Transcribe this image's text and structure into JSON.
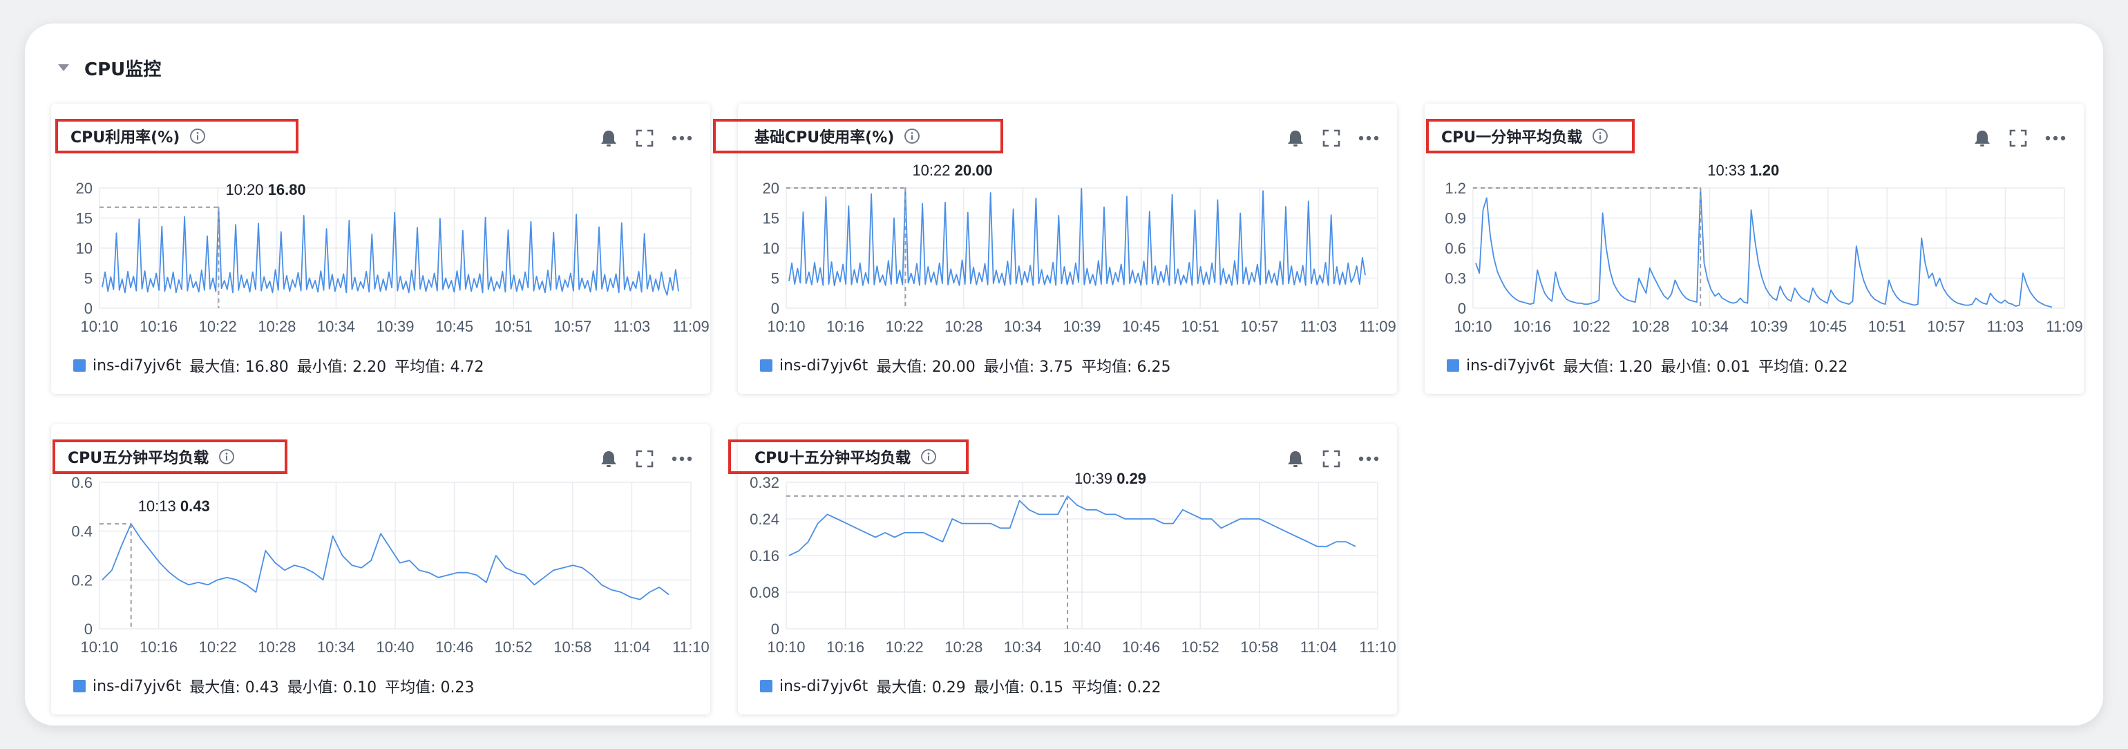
{
  "section": {
    "title": "CPU监控"
  },
  "legend_text": {
    "max": "最大值",
    "min": "最小值",
    "avg": "平均值"
  },
  "icons": {
    "bell": "bell-icon",
    "fullscreen": "fullscreen-icon",
    "more": "more-icon",
    "info": "info-icon",
    "collapse": "caret-down-icon"
  },
  "colors": {
    "series": "#4a8fe7",
    "highlight": "#e0302b",
    "grid": "#e9ebef",
    "axis_text": "#4e5969"
  },
  "cards": [
    {
      "title": "CPU利用率(%)",
      "series_name": "ins-di7yjv6t",
      "max_value": "16.80",
      "min_value": "2.20",
      "avg_value": "4.72",
      "tooltip_time": "10:20",
      "tooltip_value": "16.80"
    },
    {
      "title": "基础CPU使用率(%)",
      "series_name": "ins-di7yjv6t",
      "max_value": "20.00",
      "min_value": "3.75",
      "avg_value": "6.25",
      "tooltip_time": "10:22",
      "tooltip_value": "20.00"
    },
    {
      "title": "CPU一分钟平均负载",
      "series_name": "ins-di7yjv6t",
      "max_value": "1.20",
      "min_value": "0.01",
      "avg_value": "0.22",
      "tooltip_time": "10:33",
      "tooltip_value": "1.20"
    },
    {
      "title": "CPU五分钟平均负载",
      "series_name": "ins-di7yjv6t",
      "max_value": "0.43",
      "min_value": "0.10",
      "avg_value": "0.23",
      "tooltip_time": "10:13",
      "tooltip_value": "0.43"
    },
    {
      "title": "CPU十五分钟平均负载",
      "series_name": "ins-di7yjv6t",
      "max_value": "0.29",
      "min_value": "0.15",
      "avg_value": "0.22",
      "tooltip_time": "10:39",
      "tooltip_value": "0.29"
    }
  ],
  "chart_data": [
    {
      "type": "line",
      "title": "CPU利用率(%)",
      "ylim": [
        0,
        20
      ],
      "y_ticks": [
        "0",
        "5",
        "10",
        "15",
        "20"
      ],
      "x_ticks": [
        "10:10",
        "10:16",
        "10:22",
        "10:28",
        "10:34",
        "10:39",
        "10:45",
        "10:51",
        "10:57",
        "11:03",
        "11:09"
      ],
      "grid": true,
      "legend_position": "bottom-left",
      "series": [
        {
          "name": "ins-di7yjv6t",
          "values": [
            3.5,
            6.0,
            2.8,
            5.2,
            3.1,
            12.5,
            3.0,
            4.8,
            2.6,
            6.1,
            3.4,
            5.3,
            2.9,
            14.8,
            3.2,
            6.2,
            2.7,
            4.9,
            3.5,
            5.8,
            3.0,
            13.6,
            2.8,
            5.1,
            3.3,
            6.0,
            2.6,
            4.7,
            3.1,
            15.2,
            2.9,
            5.6,
            3.4,
            4.4,
            2.7,
            6.3,
            3.0,
            12.0,
            3.2,
            5.0,
            2.8,
            16.8,
            3.3,
            4.6,
            3.1,
            5.9,
            2.6,
            13.9,
            3.0,
            5.5,
            3.4,
            4.8,
            2.7,
            6.0,
            3.1,
            14.1,
            2.9,
            5.2,
            3.3,
            4.5,
            2.6,
            6.4,
            3.0,
            12.7,
            3.2,
            5.4,
            2.8,
            4.7,
            3.5,
            5.9,
            2.9,
            15.4,
            3.1,
            5.0,
            3.3,
            4.6,
            2.7,
            6.2,
            3.0,
            13.2,
            3.2,
            5.6,
            2.8,
            4.9,
            3.4,
            5.7,
            2.6,
            14.6,
            3.1,
            5.1,
            2.9,
            4.4,
            3.3,
            6.1,
            2.7,
            12.3,
            3.2,
            5.5,
            2.8,
            4.8,
            3.0,
            6.0,
            3.4,
            15.9,
            2.9,
            5.3,
            3.1,
            4.5,
            2.6,
            6.3,
            3.0,
            13.4,
            3.2,
            5.4,
            2.8,
            4.7,
            3.5,
            5.8,
            2.9,
            14.9,
            3.1,
            5.0,
            3.3,
            4.6,
            2.7,
            6.2,
            3.0,
            12.9,
            3.2,
            5.6,
            2.8,
            4.9,
            3.4,
            5.7,
            2.6,
            15.1,
            3.1,
            5.2,
            2.9,
            4.4,
            3.3,
            6.1,
            2.7,
            13.0,
            3.2,
            5.5,
            2.8,
            4.8,
            3.0,
            6.0,
            3.4,
            14.4,
            2.9,
            5.3,
            3.1,
            4.5,
            2.6,
            6.3,
            3.0,
            12.6,
            3.2,
            5.4,
            2.8,
            4.7,
            3.5,
            5.8,
            2.9,
            15.6,
            3.1,
            5.0,
            3.3,
            4.6,
            2.7,
            6.2,
            3.0,
            13.5,
            3.2,
            5.6,
            2.8,
            4.9,
            3.4,
            5.7,
            2.6,
            14.2,
            3.1,
            5.2,
            2.9,
            4.4,
            3.3,
            6.1,
            2.7,
            12.4,
            3.2,
            5.5,
            2.8,
            4.8,
            3.0,
            6.0,
            3.4,
            2.2,
            5.1,
            3.0,
            6.4,
            2.8
          ]
        }
      ],
      "highlight": {
        "x": "10:20",
        "y": 16.8
      }
    },
    {
      "type": "line",
      "title": "基础CPU使用率(%)",
      "ylim": [
        0,
        20
      ],
      "y_ticks": [
        "0",
        "5",
        "10",
        "15",
        "20"
      ],
      "x_ticks": [
        "10:10",
        "10:16",
        "10:22",
        "10:28",
        "10:34",
        "10:39",
        "10:45",
        "10:51",
        "10:57",
        "11:03",
        "11:09"
      ],
      "grid": true,
      "legend_position": "bottom-left",
      "series": [
        {
          "name": "ins-di7yjv6t",
          "values": [
            4.5,
            7.5,
            4.0,
            6.6,
            4.2,
            16.0,
            4.1,
            6.0,
            3.9,
            7.6,
            4.3,
            6.7,
            3.8,
            18.5,
            4.0,
            7.7,
            3.75,
            6.1,
            4.4,
            7.3,
            4.0,
            17.0,
            3.9,
            6.4,
            4.2,
            7.5,
            3.8,
            5.9,
            4.1,
            19.0,
            3.9,
            7.0,
            4.3,
            5.5,
            3.8,
            7.9,
            4.0,
            15.0,
            4.1,
            6.3,
            3.9,
            20.0,
            4.2,
            5.8,
            4.1,
            7.4,
            3.8,
            17.4,
            4.0,
            6.9,
            4.3,
            6.0,
            3.9,
            7.5,
            4.1,
            17.6,
            3.9,
            6.5,
            4.2,
            5.6,
            3.8,
            8.0,
            4.0,
            15.9,
            4.1,
            6.8,
            3.9,
            5.9,
            4.4,
            7.4,
            3.9,
            19.2,
            4.1,
            6.3,
            4.2,
            5.8,
            3.8,
            7.8,
            4.0,
            16.5,
            4.1,
            7.0,
            3.9,
            6.1,
            4.3,
            7.1,
            3.8,
            18.3,
            4.1,
            6.4,
            3.9,
            5.5,
            4.2,
            7.6,
            3.8,
            15.4,
            4.1,
            6.9,
            3.9,
            6.0,
            4.0,
            7.5,
            4.3,
            19.9,
            3.9,
            6.6,
            4.1,
            5.6,
            3.8,
            7.9,
            4.0,
            16.8,
            4.1,
            6.8,
            3.9,
            5.9,
            4.4,
            7.3,
            3.9,
            18.6,
            4.1,
            6.3,
            4.2,
            5.8,
            3.8,
            7.8,
            4.0,
            16.1,
            4.1,
            7.0,
            3.9,
            6.1,
            4.3,
            7.1,
            3.8,
            18.9,
            4.1,
            6.5,
            3.9,
            5.5,
            4.2,
            7.6,
            3.8,
            16.3,
            4.1,
            6.9,
            3.9,
            6.0,
            4.0,
            7.5,
            4.3,
            18.0,
            3.9,
            6.6,
            4.1,
            5.6,
            3.8,
            7.9,
            4.0,
            15.8,
            4.1,
            6.8,
            3.9,
            5.9,
            4.4,
            7.3,
            3.9,
            19.5,
            4.1,
            6.3,
            4.2,
            5.8,
            3.8,
            7.8,
            4.0,
            16.9,
            4.1,
            7.0,
            3.9,
            6.1,
            4.3,
            7.1,
            3.8,
            17.8,
            4.1,
            6.5,
            3.9,
            5.5,
            4.2,
            7.6,
            3.8,
            15.5,
            4.1,
            6.9,
            3.9,
            6.0,
            4.0,
            7.5,
            4.3,
            5.2,
            7.0,
            4.0,
            8.4,
            5.5
          ]
        }
      ],
      "highlight": {
        "x": "10:22",
        "y": 20.0
      }
    },
    {
      "type": "line",
      "title": "CPU一分钟平均负载",
      "ylim": [
        0,
        1.2
      ],
      "y_ticks": [
        "0",
        "0.3",
        "0.6",
        "0.9",
        "1.2"
      ],
      "x_ticks": [
        "10:10",
        "10:16",
        "10:22",
        "10:28",
        "10:34",
        "10:39",
        "10:45",
        "10:51",
        "10:57",
        "11:03",
        "11:09"
      ],
      "grid": true,
      "legend_position": "bottom-left",
      "series": [
        {
          "name": "ins-di7yjv6t",
          "values": [
            0.45,
            0.35,
            0.98,
            1.1,
            0.72,
            0.5,
            0.36,
            0.28,
            0.21,
            0.16,
            0.12,
            0.09,
            0.07,
            0.06,
            0.05,
            0.04,
            0.05,
            0.38,
            0.25,
            0.15,
            0.1,
            0.07,
            0.36,
            0.22,
            0.14,
            0.09,
            0.07,
            0.06,
            0.05,
            0.05,
            0.04,
            0.04,
            0.05,
            0.06,
            0.08,
            0.95,
            0.6,
            0.38,
            0.25,
            0.18,
            0.13,
            0.1,
            0.08,
            0.07,
            0.06,
            0.3,
            0.22,
            0.15,
            0.4,
            0.32,
            0.25,
            0.18,
            0.12,
            0.09,
            0.14,
            0.28,
            0.2,
            0.14,
            0.1,
            0.08,
            0.07,
            0.06,
            1.2,
            0.45,
            0.28,
            0.18,
            0.12,
            0.15,
            0.1,
            0.08,
            0.06,
            0.05,
            0.06,
            0.1,
            0.06,
            0.05,
            0.98,
            0.68,
            0.45,
            0.3,
            0.2,
            0.14,
            0.1,
            0.08,
            0.22,
            0.14,
            0.09,
            0.07,
            0.2,
            0.14,
            0.1,
            0.08,
            0.06,
            0.2,
            0.13,
            0.09,
            0.07,
            0.05,
            0.18,
            0.12,
            0.08,
            0.06,
            0.05,
            0.04,
            0.07,
            0.62,
            0.42,
            0.28,
            0.19,
            0.13,
            0.09,
            0.07,
            0.05,
            0.04,
            0.28,
            0.18,
            0.12,
            0.08,
            0.06,
            0.05,
            0.04,
            0.03,
            0.04,
            0.7,
            0.45,
            0.3,
            0.35,
            0.22,
            0.3,
            0.2,
            0.14,
            0.1,
            0.07,
            0.05,
            0.04,
            0.03,
            0.03,
            0.04,
            0.1,
            0.07,
            0.05,
            0.04,
            0.15,
            0.1,
            0.07,
            0.05,
            0.08,
            0.05,
            0.04,
            0.02,
            0.03,
            0.35,
            0.24,
            0.16,
            0.11,
            0.07,
            0.05,
            0.03,
            0.02,
            0.01
          ]
        }
      ],
      "highlight": {
        "x": "10:33",
        "y": 1.2
      }
    },
    {
      "type": "line",
      "title": "CPU五分钟平均负载",
      "ylim": [
        0,
        0.6
      ],
      "y_ticks": [
        "0",
        "0.2",
        "0.4",
        "0.6"
      ],
      "x_ticks": [
        "10:10",
        "10:16",
        "10:22",
        "10:28",
        "10:34",
        "10:40",
        "10:46",
        "10:52",
        "10:58",
        "11:04",
        "11:10"
      ],
      "grid": true,
      "legend_position": "bottom-left",
      "series": [
        {
          "name": "ins-di7yjv6t",
          "values": [
            0.2,
            0.24,
            0.34,
            0.43,
            0.37,
            0.32,
            0.27,
            0.23,
            0.2,
            0.18,
            0.19,
            0.18,
            0.2,
            0.21,
            0.2,
            0.18,
            0.15,
            0.32,
            0.27,
            0.24,
            0.26,
            0.25,
            0.23,
            0.2,
            0.38,
            0.3,
            0.26,
            0.25,
            0.28,
            0.39,
            0.33,
            0.27,
            0.28,
            0.24,
            0.23,
            0.21,
            0.22,
            0.23,
            0.23,
            0.22,
            0.19,
            0.3,
            0.25,
            0.23,
            0.22,
            0.18,
            0.21,
            0.24,
            0.25,
            0.26,
            0.25,
            0.22,
            0.18,
            0.16,
            0.15,
            0.13,
            0.12,
            0.15,
            0.17,
            0.14
          ]
        }
      ],
      "highlight": {
        "x": "10:13",
        "y": 0.43
      }
    },
    {
      "type": "line",
      "title": "CPU十五分钟平均负载",
      "ylim": [
        0,
        0.32
      ],
      "y_ticks": [
        "0",
        "0.08",
        "0.16",
        "0.24",
        "0.32"
      ],
      "x_ticks": [
        "10:10",
        "10:16",
        "10:22",
        "10:28",
        "10:34",
        "10:40",
        "10:46",
        "10:52",
        "10:58",
        "11:04",
        "11:10"
      ],
      "grid": true,
      "legend_position": "bottom-left",
      "series": [
        {
          "name": "ins-di7yjv6t",
          "values": [
            0.16,
            0.17,
            0.19,
            0.23,
            0.25,
            0.24,
            0.23,
            0.22,
            0.21,
            0.2,
            0.21,
            0.2,
            0.21,
            0.21,
            0.21,
            0.2,
            0.19,
            0.24,
            0.23,
            0.23,
            0.23,
            0.23,
            0.22,
            0.22,
            0.28,
            0.26,
            0.25,
            0.25,
            0.25,
            0.29,
            0.27,
            0.26,
            0.26,
            0.25,
            0.25,
            0.24,
            0.24,
            0.24,
            0.24,
            0.23,
            0.23,
            0.26,
            0.25,
            0.24,
            0.24,
            0.22,
            0.23,
            0.24,
            0.24,
            0.24,
            0.23,
            0.22,
            0.21,
            0.2,
            0.19,
            0.18,
            0.18,
            0.19,
            0.19,
            0.18
          ]
        }
      ],
      "highlight": {
        "x": "10:39",
        "y": 0.29
      }
    }
  ]
}
